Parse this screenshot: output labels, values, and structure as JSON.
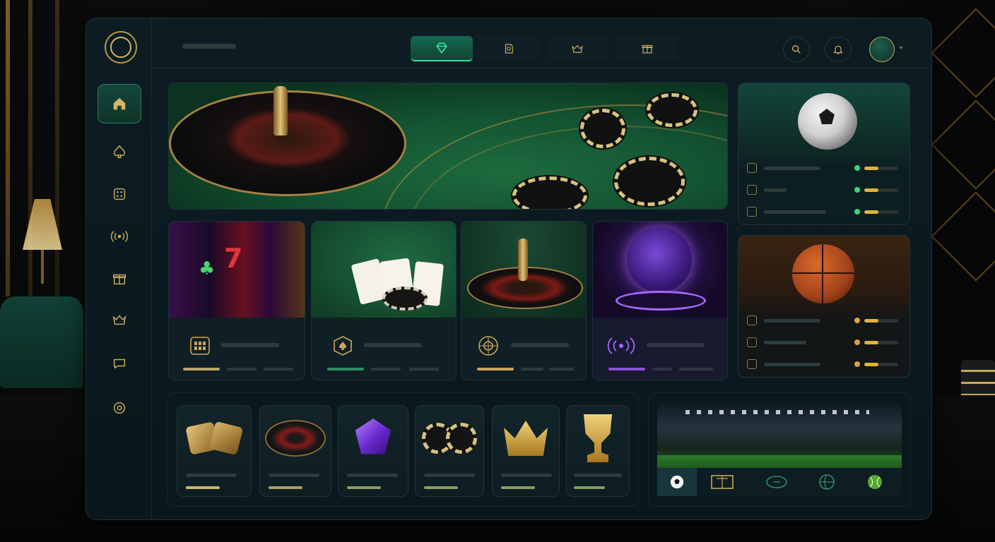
{
  "header": {
    "tabs": [
      {
        "icon": "diamond-icon",
        "active": true
      },
      {
        "icon": "chip-icon",
        "active": false
      },
      {
        "icon": "crown-icon",
        "active": false
      },
      {
        "icon": "gift-icon",
        "active": false
      }
    ],
    "actions": [
      "search-icon",
      "bell-icon"
    ]
  },
  "sidebar": {
    "items": [
      {
        "icon": "home-icon",
        "active": true
      },
      {
        "icon": "spade-icon"
      },
      {
        "icon": "dice-icon"
      },
      {
        "icon": "live-broadcast-icon"
      },
      {
        "icon": "gift-icon"
      },
      {
        "icon": "crown-icon"
      },
      {
        "icon": "chat-icon"
      },
      {
        "icon": "settings-icon"
      }
    ]
  },
  "colors": {
    "accent_gold": "#d7b465",
    "accent_green": "#2fe29c",
    "accent_purple": "#8e4fd6",
    "status_green": "#3fd17a",
    "status_orange": "#e0a33a"
  },
  "games": [
    {
      "name": "slots",
      "icon": "grid-icon",
      "progress_color": "#b8a46a"
    },
    {
      "name": "blackjack",
      "icon": "spade-badge-icon",
      "progress_color": "#2f8e66"
    },
    {
      "name": "roulette",
      "icon": "roulette-icon",
      "progress_color": "#c9a85a"
    },
    {
      "name": "live",
      "icon": "live-broadcast-icon",
      "progress_color": "#8e4fd6"
    }
  ],
  "sports": [
    {
      "name": "football",
      "rows": [
        {
          "icon": "boot-icon",
          "status": "green",
          "level": 0.42
        },
        {
          "icon": "target-icon",
          "status": "green",
          "level": 0.42
        },
        {
          "icon": "goal-icon",
          "status": "green",
          "level": 0.42
        }
      ]
    },
    {
      "name": "basketball",
      "rows": [
        {
          "icon": "hoop-icon",
          "status": "orange",
          "level": 0.42
        },
        {
          "icon": "ball-icon",
          "status": "orange",
          "level": 0.42
        },
        {
          "icon": "play-icon",
          "status": "orange",
          "level": 0.42
        }
      ]
    }
  ],
  "categories": [
    "dice-icon",
    "roulette-wheel-icon",
    "gem-icon",
    "chips-icon",
    "crown-icon",
    "trophy-icon"
  ],
  "stadium_tabs": [
    "football-icon",
    "tennis-court-icon",
    "american-football-icon",
    "basketball-icon",
    "tennis-ball-icon"
  ]
}
